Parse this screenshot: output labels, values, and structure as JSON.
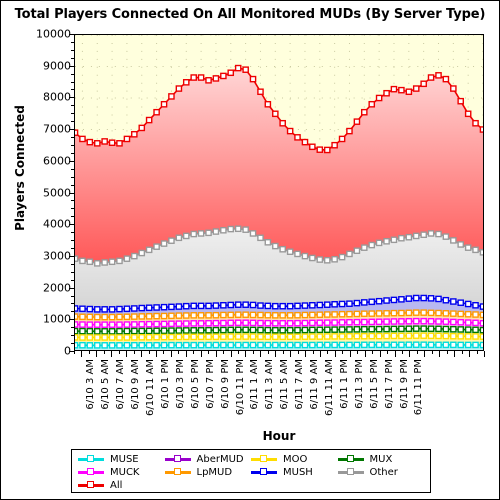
{
  "chart_data": {
    "type": "area",
    "title": "Total Players Connected On All Monitored MUDs (By Server Type)",
    "xlabel": "Hour",
    "ylabel": "Players Connected",
    "ylim": [
      0,
      10000
    ],
    "ytick_step": 1000,
    "ytick_labels": [
      "0",
      "1000",
      "2000",
      "3000",
      "4000",
      "5000",
      "6000",
      "7000",
      "8000",
      "9000",
      "10000"
    ],
    "grid": true,
    "legend_position": "bottom",
    "stacked": true,
    "plot_background": "#FFFFDD",
    "x": [
      "6/10 2 AM",
      "6/10 3 AM",
      "6/10 4 AM",
      "6/10 5 AM",
      "6/10 6 AM",
      "6/10 7 AM",
      "6/10 8 AM",
      "6/10 9 AM",
      "6/10 10 AM",
      "6/10 11 AM",
      "6/10 12 PM",
      "6/10 1 PM",
      "6/10 2 PM",
      "6/10 3 PM",
      "6/10 4 PM",
      "6/10 5 PM",
      "6/10 6 PM",
      "6/10 7 PM",
      "6/10 8 PM",
      "6/10 9 PM",
      "6/10 10 PM",
      "6/10 11 PM",
      "6/11 12 AM",
      "6/11 1 AM",
      "6/11 2 AM",
      "6/11 3 AM",
      "6/11 4 AM",
      "6/11 5 AM",
      "6/11 6 AM",
      "6/11 7 AM",
      "6/11 8 AM",
      "6/11 9 AM",
      "6/11 10 AM",
      "6/11 11 AM",
      "6/11 12 PM",
      "6/11 1 PM",
      "6/11 2 PM",
      "6/11 3 PM",
      "6/11 4 PM",
      "6/11 5 PM",
      "6/11 6 PM",
      "6/11 7 PM",
      "6/11 8 PM",
      "6/11 9 PM",
      "6/11 10 PM",
      "6/11 11 PM",
      "6/12 12 AM"
    ],
    "xtick_labels": [
      "6/10 3 AM",
      "6/10 5 AM",
      "6/10 7 AM",
      "6/10 9 AM",
      "6/10 11 AM",
      "6/10 1 PM",
      "6/10 3 PM",
      "6/10 5 PM",
      "6/10 7 PM",
      "6/10 9 PM",
      "6/10 11 PM",
      "6/11 1 AM",
      "6/11 3 AM",
      "6/11 5 AM",
      "6/11 7 AM",
      "6/11 9 AM",
      "6/11 11 AM",
      "6/11 1 PM",
      "6/11 3 PM",
      "6/11 5 PM",
      "6/11 7 PM",
      "6/11 9 PM",
      "6/11 11 PM"
    ],
    "series": [
      {
        "name": "All",
        "color": "#EE0000",
        "fill_top": "#FFD6D6",
        "fill_bottom": "#FF2020",
        "values": [
          6900,
          6700,
          6600,
          6560,
          6620,
          6580,
          6560,
          6700,
          6850,
          7050,
          7300,
          7550,
          7800,
          8050,
          8300,
          8500,
          8650,
          8650,
          8560,
          8620,
          8700,
          8800,
          8950,
          8900,
          8600,
          8200,
          7800,
          7500,
          7200,
          6950,
          6750,
          6600,
          6450,
          6360,
          6350,
          6500,
          6700,
          6950,
          7250,
          7550,
          7800,
          8000,
          8150,
          8280,
          8250,
          8200,
          8300,
          8450,
          8650,
          8720,
          8600,
          8300,
          7900,
          7500,
          7200,
          7000
        ],
        "values_note": "topmost stacked total; 47 hourly points 6/10 2AM - 6/12 12AM"
      },
      {
        "name": "Other",
        "color": "#999999",
        "fill_top": "#EFEFEF",
        "fill_bottom": "#C8C8C8",
        "values": [
          2900,
          2830,
          2800,
          2750,
          2780,
          2800,
          2830,
          2900,
          2980,
          3080,
          3180,
          3280,
          3380,
          3470,
          3560,
          3620,
          3680,
          3700,
          3720,
          3760,
          3800,
          3840,
          3850,
          3820,
          3700,
          3560,
          3420,
          3300,
          3200,
          3120,
          3050,
          2980,
          2920,
          2870,
          2850,
          2880,
          2950,
          3050,
          3150,
          3250,
          3330,
          3400,
          3450,
          3500,
          3550,
          3580,
          3620,
          3660,
          3700,
          3680,
          3600,
          3480,
          3350,
          3250,
          3180,
          3100
        ]
      },
      {
        "name": "MUSH",
        "color": "#0000EE",
        "fill": "#B8B8F0",
        "values": [
          1320,
          1310,
          1300,
          1290,
          1290,
          1290,
          1300,
          1310,
          1320,
          1330,
          1340,
          1350,
          1360,
          1370,
          1380,
          1390,
          1400,
          1400,
          1400,
          1410,
          1420,
          1430,
          1440,
          1440,
          1430,
          1410,
          1400,
          1390,
          1390,
          1390,
          1400,
          1410,
          1420,
          1430,
          1440,
          1450,
          1460,
          1470,
          1490,
          1510,
          1530,
          1550,
          1570,
          1590,
          1610,
          1630,
          1650,
          1650,
          1640,
          1620,
          1580,
          1540,
          1500,
          1460,
          1420,
          1380
        ]
      },
      {
        "name": "LpMUD",
        "color": "#FF9900",
        "fill": "#FFE0B0",
        "values": [
          1060,
          1055,
          1050,
          1045,
          1045,
          1045,
          1050,
          1055,
          1060,
          1065,
          1070,
          1075,
          1080,
          1085,
          1090,
          1095,
          1100,
          1100,
          1100,
          1105,
          1110,
          1115,
          1120,
          1120,
          1115,
          1110,
          1105,
          1100,
          1100,
          1100,
          1105,
          1110,
          1115,
          1120,
          1125,
          1130,
          1135,
          1140,
          1145,
          1150,
          1155,
          1160,
          1165,
          1170,
          1175,
          1180,
          1185,
          1185,
          1180,
          1175,
          1165,
          1155,
          1145,
          1135,
          1125,
          1115
        ]
      },
      {
        "name": "MUCK",
        "color": "#FF00FF",
        "fill": "#FFC8F0",
        "values": [
          810,
          808,
          805,
          803,
          803,
          803,
          805,
          808,
          812,
          816,
          820,
          824,
          828,
          832,
          836,
          840,
          844,
          846,
          848,
          852,
          856,
          860,
          864,
          864,
          860,
          856,
          852,
          848,
          848,
          848,
          852,
          856,
          860,
          864,
          868,
          872,
          876,
          880,
          884,
          888,
          892,
          896,
          900,
          904,
          908,
          912,
          916,
          916,
          912,
          906,
          898,
          890,
          880,
          870,
          860,
          850
        ]
      },
      {
        "name": "MUX",
        "color": "#007700",
        "fill": "#CCE8CC",
        "values": [
          600,
          598,
          596,
          594,
          594,
          594,
          596,
          598,
          601,
          604,
          607,
          610,
          613,
          616,
          619,
          622,
          625,
          626,
          628,
          631,
          634,
          637,
          640,
          640,
          637,
          634,
          631,
          628,
          628,
          628,
          631,
          634,
          637,
          640,
          643,
          646,
          649,
          652,
          655,
          658,
          661,
          664,
          667,
          670,
          673,
          676,
          679,
          679,
          676,
          672,
          666,
          660,
          653,
          646,
          639,
          632
        ]
      },
      {
        "name": "MOO",
        "color": "#FFDD00",
        "fill": "#FFF6AA",
        "values": [
          400,
          399,
          398,
          397,
          397,
          397,
          398,
          399,
          401,
          403,
          405,
          407,
          409,
          411,
          413,
          415,
          417,
          418,
          419,
          421,
          423,
          425,
          427,
          427,
          425,
          423,
          421,
          419,
          419,
          419,
          421,
          423,
          425,
          427,
          429,
          431,
          433,
          435,
          437,
          439,
          441,
          443,
          445,
          447,
          449,
          451,
          453,
          453,
          451,
          448,
          444,
          440,
          436,
          432,
          428,
          424
        ]
      },
      {
        "name": "MUSE",
        "color": "#00DDDD",
        "fill": "#B8F2F2",
        "values": [
          150,
          150,
          149,
          149,
          149,
          149,
          149,
          150,
          150,
          151,
          152,
          152,
          153,
          154,
          154,
          155,
          156,
          156,
          157,
          157,
          158,
          159,
          159,
          159,
          159,
          158,
          158,
          157,
          157,
          157,
          158,
          159,
          159,
          160,
          160,
          161,
          161,
          162,
          162,
          163,
          163,
          164,
          164,
          165,
          165,
          166,
          166,
          166,
          165,
          165,
          164,
          163,
          162,
          161,
          160,
          159
        ]
      }
    ],
    "legend": [
      [
        {
          "label": "MUSE",
          "color": "#00DDDD"
        },
        {
          "label": "AberMUD",
          "color": "#9900CC"
        },
        {
          "label": "MOO",
          "color": "#FFDD00"
        },
        {
          "label": "MUX",
          "color": "#007700"
        }
      ],
      [
        {
          "label": "MUCK",
          "color": "#FF00FF"
        },
        {
          "label": "LpMUD",
          "color": "#FF9900"
        },
        {
          "label": "MUSH",
          "color": "#0000EE"
        },
        {
          "label": "Other",
          "color": "#999999"
        }
      ],
      [
        {
          "label": "All",
          "color": "#EE0000"
        }
      ]
    ]
  }
}
